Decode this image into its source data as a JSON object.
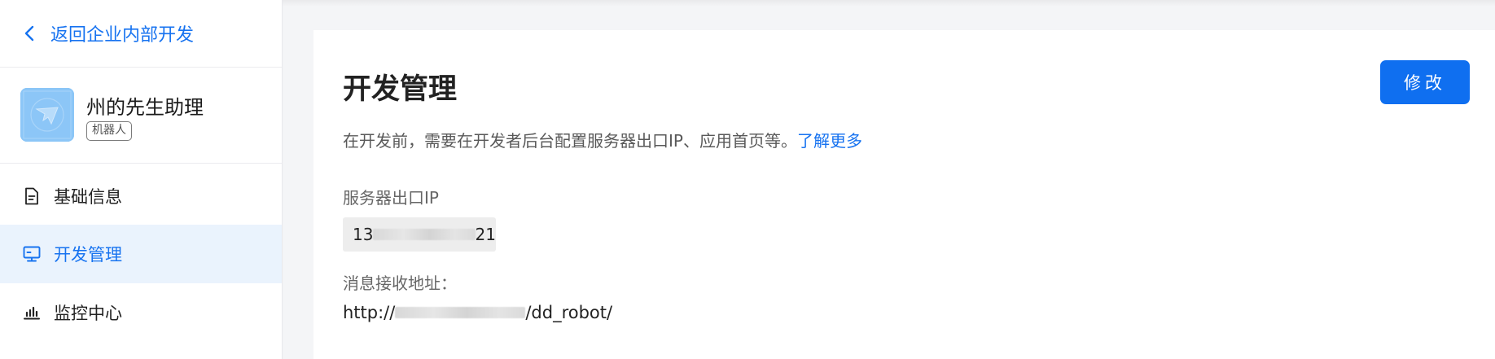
{
  "sidebar": {
    "back_label": "返回企业内部开发",
    "app": {
      "name": "州的先生助理",
      "tag": "机器人"
    },
    "items": [
      {
        "label": "基础信息",
        "icon": "document-icon",
        "active": false
      },
      {
        "label": "开发管理",
        "icon": "monitor-icon",
        "active": true
      },
      {
        "label": "监控中心",
        "icon": "bar-chart-icon",
        "active": false
      }
    ]
  },
  "main": {
    "title": "开发管理",
    "edit_label": "修改",
    "description": "在开发前，需要在开发者后台配置服务器出口IP、应用首页等。",
    "learn_more": "了解更多",
    "server_ip_label": "服务器出口IP",
    "server_ip_prefix": "13",
    "server_ip_suffix": "21",
    "message_url_label": "消息接收地址：",
    "message_url_prefix": "http://",
    "message_url_suffix": "/dd_robot/"
  },
  "colors": {
    "accent": "#1773f0",
    "button": "#0f6ff0",
    "active_bg": "#eaf3fd"
  }
}
